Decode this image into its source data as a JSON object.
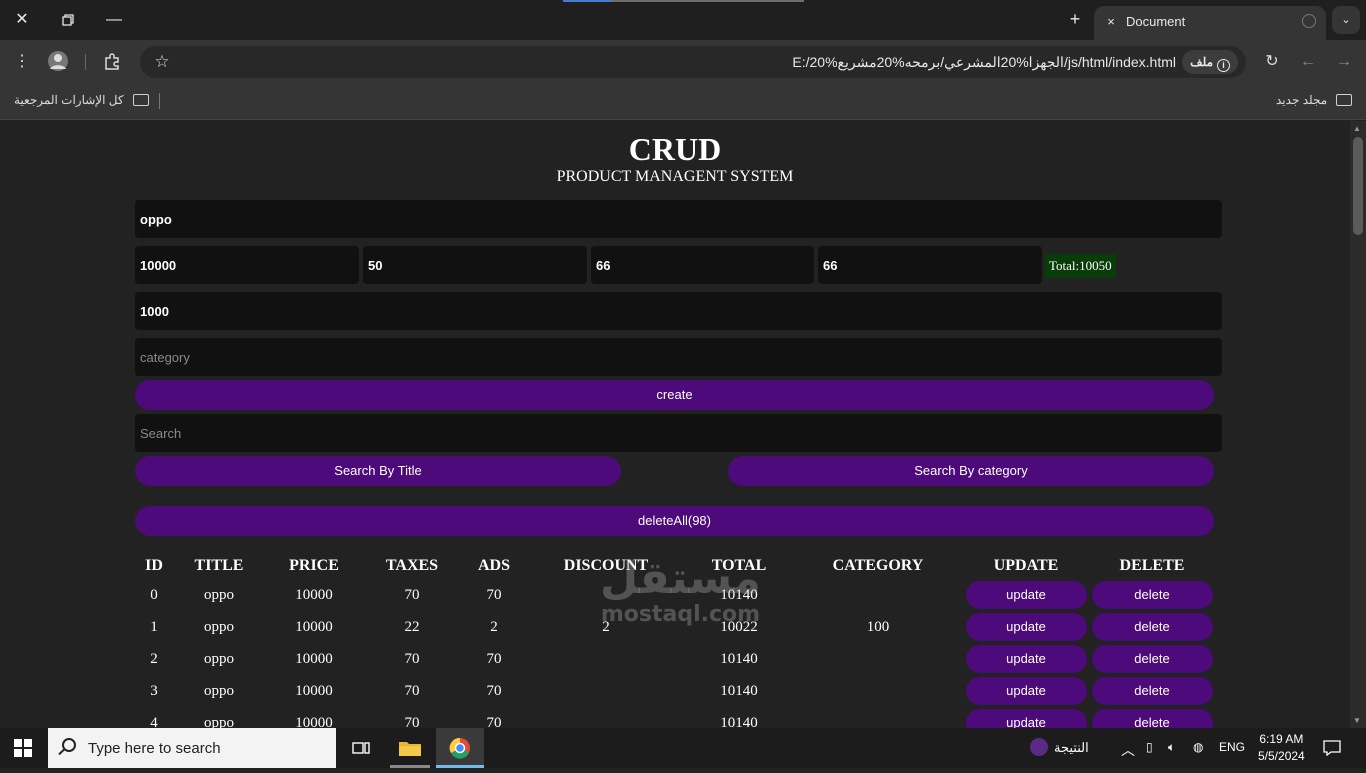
{
  "browser": {
    "tab_title": "Document",
    "tab_close_icon": "×",
    "new_tab_icon": "+",
    "url": "E:/الجهزا%20المشرعي/برمحه%20مشريع%20/js/html/index.html",
    "url_chip": "ملف",
    "bookmarks": {
      "left_folder": "كل الإشارات المرجعية",
      "right_folder": "مجلد جديد"
    }
  },
  "app": {
    "title": "CRUD",
    "subtitle": "PRODUCT MANAGENT SYSTEM",
    "form": {
      "title_value": "oppo",
      "price_value": "10000",
      "taxes_value": "50",
      "ads_value": "66",
      "discount_value": "66",
      "total_label": "Total:10050",
      "count_value": "1000",
      "category_placeholder": "category",
      "create_label": "create",
      "search_placeholder": "Search",
      "search_title_label": "Search By Title",
      "search_category_label": "Search By category",
      "delete_all_label": "deleteAll(98)"
    },
    "table": {
      "headers": [
        "ID",
        "TITLE",
        "PRICE",
        "TAXES",
        "ADS",
        "DISCOUNT",
        "TOTAL",
        "CATEGORY",
        "UPDATE",
        "DELETE"
      ],
      "update_label": "update",
      "delete_label": "delete",
      "rows": [
        {
          "id": "0",
          "title": "oppo",
          "price": "10000",
          "taxes": "70",
          "ads": "70",
          "discount": "",
          "total": "10140",
          "category": ""
        },
        {
          "id": "1",
          "title": "oppo",
          "price": "10000",
          "taxes": "22",
          "ads": "2",
          "discount": "2",
          "total": "10022",
          "category": "100"
        },
        {
          "id": "2",
          "title": "oppo",
          "price": "10000",
          "taxes": "70",
          "ads": "70",
          "discount": "",
          "total": "10140",
          "category": ""
        },
        {
          "id": "3",
          "title": "oppo",
          "price": "10000",
          "taxes": "70",
          "ads": "70",
          "discount": "",
          "total": "10140",
          "category": ""
        },
        {
          "id": "4",
          "title": "oppo",
          "price": "10000",
          "taxes": "70",
          "ads": "70",
          "discount": "",
          "total": "10140",
          "category": ""
        }
      ]
    }
  },
  "watermark": {
    "arabic": "مستقل",
    "latin": "mostaql.com"
  },
  "taskbar": {
    "search_text": "Type here to search",
    "weather_text": "النتيجة",
    "lang": "ENG",
    "time": "6:19 AM",
    "date": "5/5/2024"
  },
  "colors": {
    "page_bg": "#222222",
    "input_bg": "#111111",
    "button_purple": "#4d0a7a",
    "total_green": "#083c08"
  }
}
